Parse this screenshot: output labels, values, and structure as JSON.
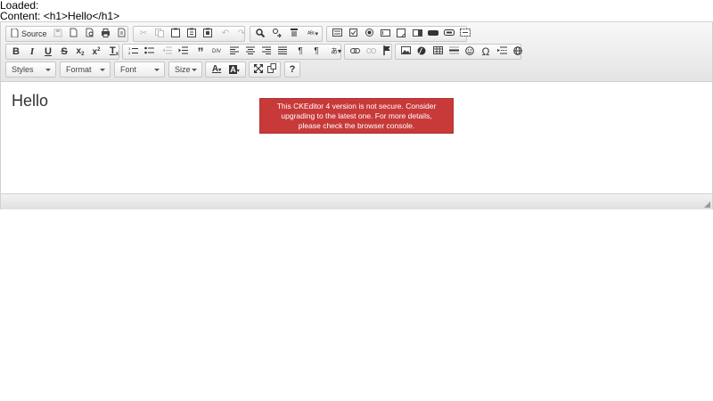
{
  "status": {
    "loaded": "Loaded:",
    "content": "Content: <h1>Hello</h1>"
  },
  "toolbar": {
    "row1": {
      "document": [
        {
          "name": "source-button",
          "icon": "source-icon",
          "label": "Source"
        },
        {
          "name": "save-button",
          "icon": "save-icon"
        },
        {
          "name": "new-page-button",
          "icon": "new-page-icon"
        },
        {
          "name": "preview-button",
          "icon": "preview-icon"
        },
        {
          "name": "print-button",
          "icon": "print-icon"
        },
        {
          "name": "templates-button",
          "icon": "templates-icon"
        }
      ],
      "clipboard": [
        {
          "name": "cut-button",
          "icon": "cut-icon",
          "disabled": true
        },
        {
          "name": "copy-button",
          "icon": "copy-icon",
          "disabled": true
        },
        {
          "name": "paste-button",
          "icon": "paste-icon"
        },
        {
          "name": "paste-text-button",
          "icon": "paste-text-icon"
        },
        {
          "name": "paste-from-word-button",
          "icon": "paste-word-icon"
        },
        {
          "name": "undo-button",
          "icon": "undo-icon",
          "disabled": true
        },
        {
          "name": "redo-button",
          "icon": "redo-icon",
          "disabled": true
        }
      ],
      "editing": [
        {
          "name": "find-button",
          "icon": "find-icon"
        },
        {
          "name": "replace-button",
          "icon": "replace-icon"
        },
        {
          "name": "select-all-button",
          "icon": "select-all-icon"
        },
        {
          "name": "spellcheck-button",
          "icon": "spellcheck-icon"
        }
      ],
      "forms": [
        {
          "name": "form-button",
          "icon": "form-icon"
        },
        {
          "name": "checkbox-button",
          "icon": "checkbox-icon"
        },
        {
          "name": "radio-button",
          "icon": "radio-icon"
        },
        {
          "name": "text-field-button",
          "icon": "text-field-icon"
        },
        {
          "name": "textarea-button",
          "icon": "textarea-icon"
        },
        {
          "name": "select-field-button",
          "icon": "select-field-icon"
        },
        {
          "name": "form-button-button",
          "icon": "button-icon"
        },
        {
          "name": "image-button-button",
          "icon": "image-button-icon"
        },
        {
          "name": "hidden-field-button",
          "icon": "hidden-field-icon"
        }
      ]
    },
    "row2": {
      "basicstyles": [
        {
          "name": "bold-button",
          "icon": "bold-icon",
          "glyph": "B"
        },
        {
          "name": "italic-button",
          "icon": "italic-icon",
          "glyph": "I"
        },
        {
          "name": "underline-button",
          "icon": "underline-icon",
          "glyph": "U"
        },
        {
          "name": "strike-button",
          "icon": "strike-icon",
          "glyph": "S"
        },
        {
          "name": "subscript-button",
          "icon": "subscript-icon",
          "glyph": "x"
        },
        {
          "name": "superscript-button",
          "icon": "superscript-icon",
          "glyph": "x"
        },
        {
          "name": "remove-format-button",
          "icon": "remove-format-icon",
          "glyph": "T"
        }
      ],
      "paragraph": [
        {
          "name": "numbered-list-button",
          "icon": "numbered-list-icon"
        },
        {
          "name": "bulleted-list-button",
          "icon": "bulleted-list-icon"
        },
        {
          "name": "outdent-button",
          "icon": "outdent-icon",
          "disabled": true
        },
        {
          "name": "indent-button",
          "icon": "indent-icon"
        },
        {
          "name": "blockquote-button",
          "icon": "blockquote-icon"
        },
        {
          "name": "div-button",
          "icon": "div-icon"
        },
        {
          "name": "align-left-button",
          "icon": "align-left-icon"
        },
        {
          "name": "align-center-button",
          "icon": "align-center-icon"
        },
        {
          "name": "align-right-button",
          "icon": "align-right-icon"
        },
        {
          "name": "justify-button",
          "icon": "justify-icon"
        },
        {
          "name": "bidi-ltr-button",
          "icon": "bidi-ltr-icon"
        },
        {
          "name": "bidi-rtl-button",
          "icon": "bidi-rtl-icon"
        },
        {
          "name": "language-button",
          "icon": "language-icon"
        }
      ],
      "links": [
        {
          "name": "link-button",
          "icon": "link-icon"
        },
        {
          "name": "unlink-button",
          "icon": "unlink-icon",
          "disabled": true
        },
        {
          "name": "anchor-button",
          "icon": "anchor-icon"
        }
      ],
      "insert": [
        {
          "name": "image-button",
          "icon": "image-icon"
        },
        {
          "name": "flash-button",
          "icon": "flash-icon"
        },
        {
          "name": "table-button",
          "icon": "table-icon"
        },
        {
          "name": "horizontal-rule-button",
          "icon": "horizontal-rule-icon"
        },
        {
          "name": "smiley-button",
          "icon": "smiley-icon"
        },
        {
          "name": "special-char-button",
          "icon": "omega-icon",
          "glyph": "Ω"
        },
        {
          "name": "page-break-button",
          "icon": "page-break-icon"
        },
        {
          "name": "iframe-button",
          "icon": "iframe-icon"
        }
      ]
    },
    "row3": {
      "combos": {
        "styles": "Styles",
        "format": "Format",
        "font": "Font",
        "size": "Size"
      },
      "colors": [
        {
          "name": "text-color-button",
          "icon": "text-color-icon",
          "glyph": "A"
        },
        {
          "name": "bg-color-button",
          "icon": "bg-color-icon",
          "glyph": "A"
        }
      ],
      "tools": [
        {
          "name": "maximize-button",
          "icon": "maximize-icon"
        },
        {
          "name": "show-blocks-button",
          "icon": "show-blocks-icon"
        }
      ],
      "about": [
        {
          "name": "about-button",
          "icon": "about-icon",
          "glyph": "?"
        }
      ]
    }
  },
  "document": {
    "heading": "Hello"
  },
  "notice": {
    "text": "This CKEditor 4 version is not secure. Consider upgrading to the latest one. For more details, please check the browser console.",
    "color": "#c83939"
  }
}
